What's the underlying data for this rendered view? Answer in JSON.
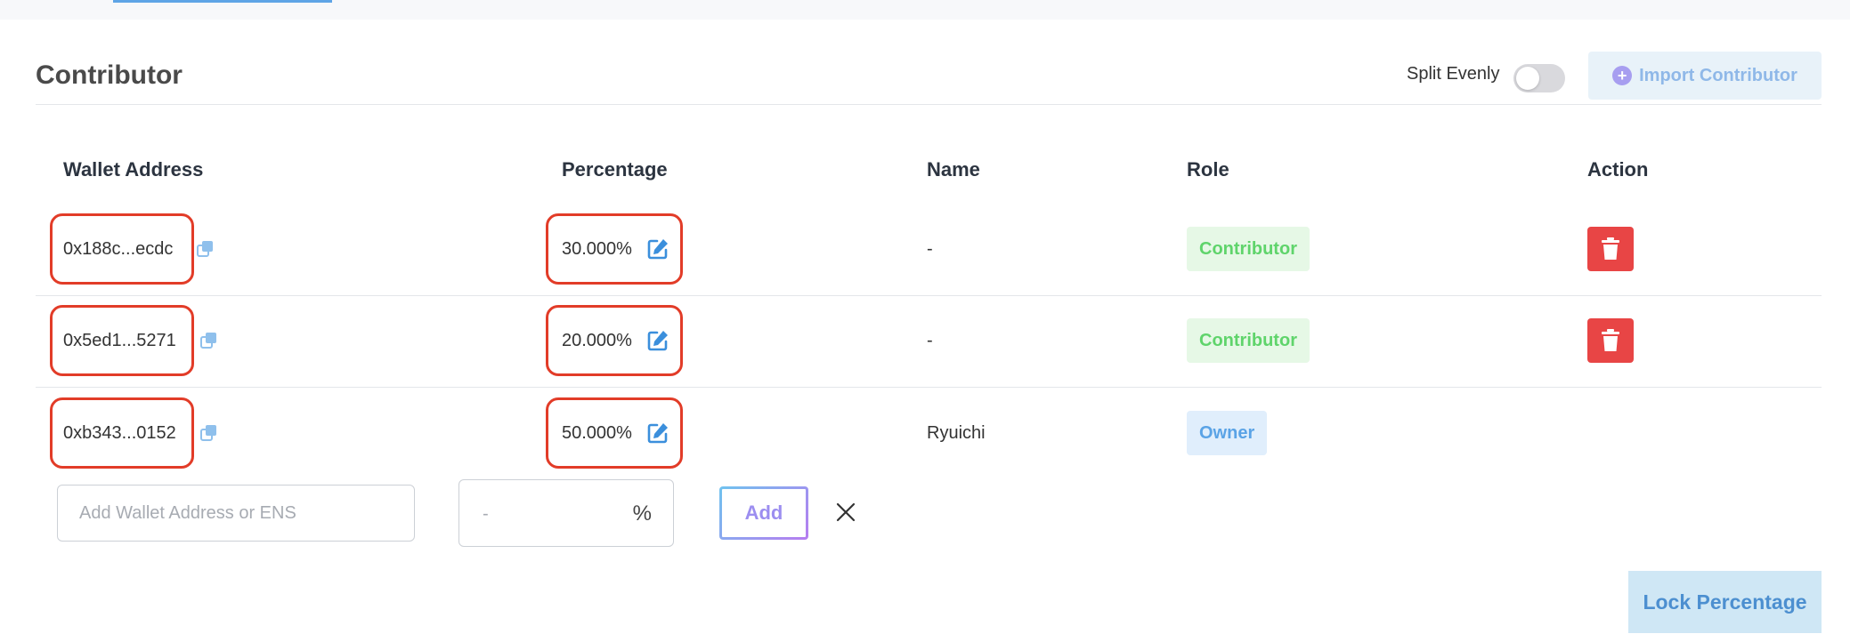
{
  "section": {
    "title": "Contributor",
    "split_evenly_label": "Split Evenly",
    "split_evenly_enabled": false,
    "import_button_label": "Import Contributor"
  },
  "table": {
    "headers": {
      "wallet": "Wallet Address",
      "percentage": "Percentage",
      "name": "Name",
      "role": "Role",
      "action": "Action"
    },
    "rows": [
      {
        "wallet": "0x188c...ecdc",
        "percentage": "30.000%",
        "name": "-",
        "role": "Contributor",
        "deletable": true
      },
      {
        "wallet": "0x5ed1...5271",
        "percentage": "20.000%",
        "name": "-",
        "role": "Contributor",
        "deletable": true
      },
      {
        "wallet": "0xb343...0152",
        "percentage": "50.000%",
        "name": "Ryuichi",
        "role": "Owner",
        "deletable": false
      }
    ]
  },
  "add_form": {
    "wallet_placeholder": "Add Wallet Address or ENS",
    "percentage_placeholder": "-",
    "percent_symbol": "%",
    "add_button_label": "Add"
  },
  "lock_button_label": "Lock Percentage",
  "colors": {
    "accent_blue": "#5aa3e6",
    "highlight_red": "#e23c28",
    "delete_red": "#e84545",
    "contributor_green": "#5fd46b"
  },
  "icons": {
    "copy": "copy-icon",
    "edit": "edit-icon",
    "delete": "trash-icon",
    "import": "plus-circle-icon",
    "close": "close-icon"
  }
}
